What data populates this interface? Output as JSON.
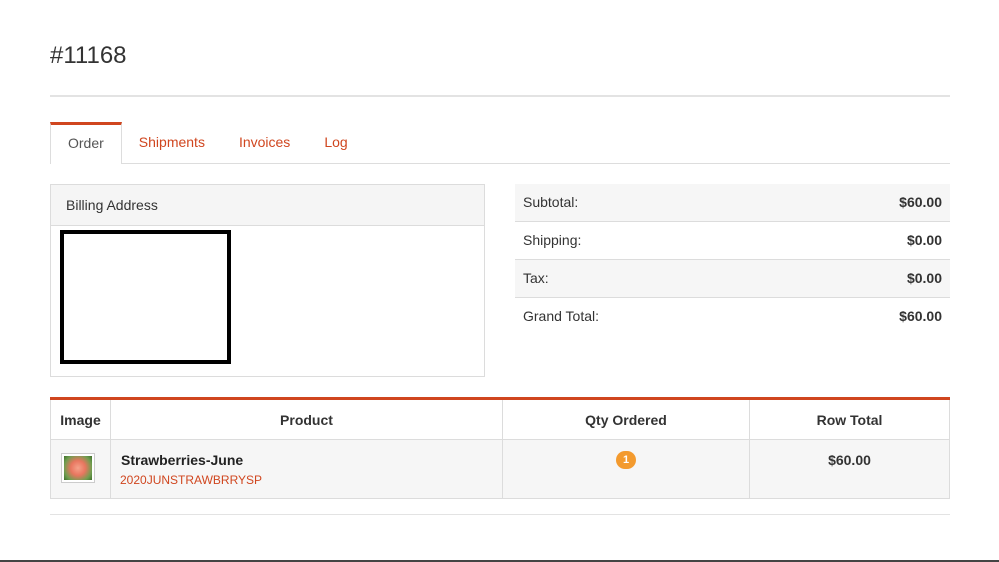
{
  "order": {
    "number": "#11168"
  },
  "tabs": [
    {
      "label": "Order",
      "active": true
    },
    {
      "label": "Shipments",
      "active": false
    },
    {
      "label": "Invoices",
      "active": false
    },
    {
      "label": "Log",
      "active": false
    }
  ],
  "billing": {
    "heading": "Billing Address"
  },
  "totals": [
    {
      "label": "Subtotal:",
      "value": "$60.00"
    },
    {
      "label": "Shipping:",
      "value": "$0.00"
    },
    {
      "label": "Tax:",
      "value": "$0.00"
    },
    {
      "label": "Grand Total:",
      "value": "$60.00"
    }
  ],
  "items": {
    "headers": [
      "Image",
      "Product",
      "Qty Ordered",
      "Row Total"
    ],
    "rows": [
      {
        "image_icon": "strawberry-product-thumbnail",
        "product_name": "Strawberries-June",
        "sku": "2020JUNSTRAWBRRYSP",
        "qty": "1",
        "row_total": "$60.00"
      }
    ]
  },
  "colors": {
    "accent": "#d0461f",
    "badge": "#f39a2e",
    "row_alt": "#f6f6f6",
    "border": "#dcdcdc"
  }
}
